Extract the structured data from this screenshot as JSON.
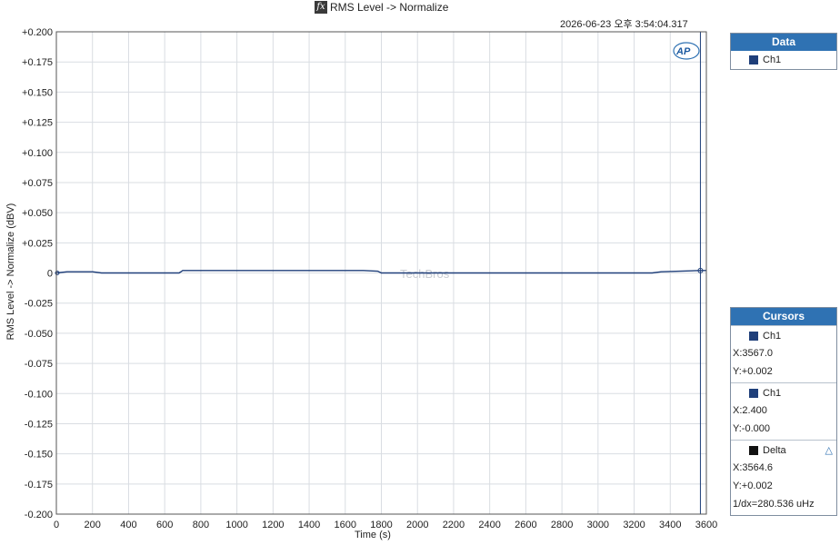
{
  "header": {
    "fx_icon": "fx",
    "title": "RMS Level -> Normalize",
    "timestamp": "2026-06-23 오후 3:54:04.317"
  },
  "chart_data": {
    "type": "line",
    "title": "RMS Level -> Normalize",
    "xlabel": "Time (s)",
    "ylabel": "RMS Level -> Normalize (dBV)",
    "xlim": [
      0,
      3600
    ],
    "ylim": [
      -0.2,
      0.2
    ],
    "x_ticks": [
      "0",
      "200",
      "400",
      "600",
      "800",
      "1000",
      "1200",
      "1400",
      "1600",
      "1800",
      "2000",
      "2200",
      "2400",
      "2600",
      "2800",
      "3000",
      "3200",
      "3400",
      "3600"
    ],
    "y_ticks": [
      "+0.200",
      "+0.175",
      "+0.150",
      "+0.125",
      "+0.100",
      "+0.075",
      "+0.050",
      "+0.025",
      "0",
      "-0.025",
      "-0.050",
      "-0.075",
      "-0.100",
      "-0.125",
      "-0.150",
      "-0.175",
      "-0.200"
    ],
    "grid": true,
    "series": [
      {
        "name": "Ch1",
        "color": "#1f3f7a",
        "x": [
          0,
          60,
          200,
          250,
          680,
          700,
          1000,
          1400,
          1700,
          1780,
          1800,
          2300,
          2500,
          3300,
          3350,
          3567,
          3600
        ],
        "y": [
          0.0,
          0.001,
          0.001,
          0.0,
          0.0,
          0.002,
          0.002,
          0.002,
          0.002,
          0.0015,
          0.0,
          0.0,
          0.0,
          0.0,
          0.001,
          0.002,
          0.002
        ]
      }
    ],
    "cursor_x": 3567.0
  },
  "watermark": "TechBros",
  "logo": {
    "text": "AP",
    "icon": "ap-logo"
  },
  "legend": {
    "header": "Data",
    "items": [
      {
        "label": "Ch1",
        "color": "#1f3f7a"
      }
    ]
  },
  "cursors": {
    "header": "Cursors",
    "cursor1": {
      "label": "Ch1",
      "color": "#1f3f7a",
      "x": "X:3567.0",
      "y": "Y:+0.002"
    },
    "cursor2": {
      "label": "Ch1",
      "color": "#1f3f7a",
      "x": "X:2.400",
      "y": "Y:-0.000"
    },
    "delta": {
      "label": "Delta",
      "color": "#111111",
      "icon": "delta-triangle-icon",
      "x": "X:3564.6",
      "y": "Y:+0.002",
      "inv": "1/dx=280.536 uHz"
    }
  }
}
